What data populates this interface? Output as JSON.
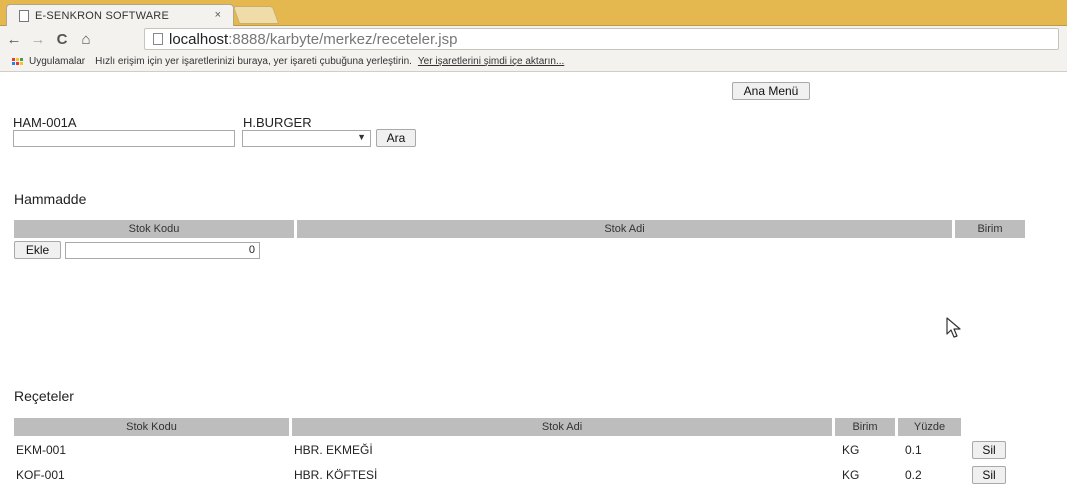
{
  "browser": {
    "tab_title": "E-SENKRON SOFTWARE",
    "tab_close": "×",
    "url_host": "localhost",
    "url_path": ":8888/karbyte/merkez/receteler.jsp",
    "back": "←",
    "forward": "→",
    "reload": "C",
    "home": "⌂",
    "bookmarks": {
      "apps_label": "Uygulamalar",
      "hint": "Hızlı erişim için yer işaretlerinizi buraya, yer işareti çubuğuna yerleştirin.",
      "import_link": "Yer işaretlerini şimdi içe aktarın..."
    }
  },
  "header": {
    "main_menu_button": "Ana Menü"
  },
  "search": {
    "code_label": "HAM-001A",
    "code_value": "",
    "product_label": "H.BURGER",
    "product_selected": "",
    "search_button": "Ara"
  },
  "raw_material": {
    "title": "Hammadde",
    "columns": [
      "Stok Kodu",
      "Stok Adi",
      "Birim"
    ],
    "add_button": "Ekle",
    "quantity_value": "0"
  },
  "recipes": {
    "title": "Reçeteler",
    "columns": [
      "Stok Kodu",
      "Stok Adi",
      "Birim",
      "Yüzde"
    ],
    "rows": [
      {
        "code": "EKM-001",
        "name": "HBR. EKMEĞİ",
        "unit": "KG",
        "percent": "0.1",
        "delete": "Sil"
      },
      {
        "code": "KOF-001",
        "name": "HBR. KÖFTESİ",
        "unit": "KG",
        "percent": "0.2",
        "delete": "Sil"
      }
    ]
  },
  "colors": {
    "tabbar": "#e4b84f",
    "header_gray": "#bdbdbd",
    "apps_icon": [
      "#e53935",
      "#fbc02d",
      "#43a047",
      "#1e88e5"
    ]
  }
}
